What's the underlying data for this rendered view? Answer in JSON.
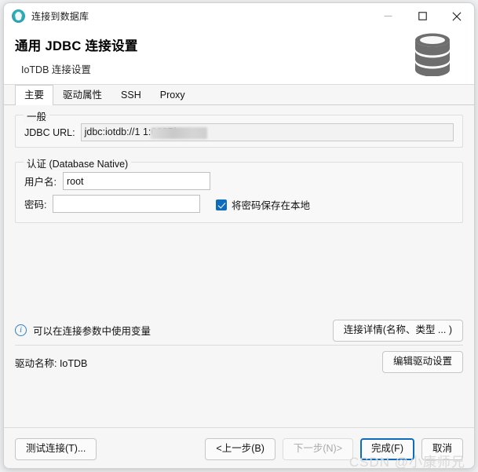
{
  "window": {
    "title": "连接到数据库",
    "app_icon": "dbeaver-icon",
    "controls": {
      "minimize": "minimize-icon",
      "maximize": "maximize-icon",
      "close": "close-icon"
    }
  },
  "header": {
    "title": "通用 JDBC 连接设置",
    "subtitle": "IoTDB 连接设置",
    "icon": "database-icon"
  },
  "tabs": [
    {
      "label": "主要",
      "active": true
    },
    {
      "label": "驱动属性",
      "active": false
    },
    {
      "label": "SSH",
      "active": false
    },
    {
      "label": "Proxy",
      "active": false
    }
  ],
  "general": {
    "legend": "一般",
    "jdbc_url_label": "JDBC URL:",
    "jdbc_url_value": "jdbc:iotdb://1                    1:6667/",
    "jdbc_url_prefix": "jdbc:iotdb://1",
    "jdbc_url_suffix": "1:6667/",
    "jdbc_url_redacted": true
  },
  "auth": {
    "legend": "认证 (Database Native)",
    "username_label": "用户名:",
    "username_value": "root",
    "password_label": "密码:",
    "password_value": "",
    "save_password_label": "将密码保存在本地",
    "save_password_checked": true
  },
  "info": {
    "icon": "info-icon",
    "text": "可以在连接参数中使用变量",
    "connection_details_button": "连接详情(名称、类型 ... )"
  },
  "driver": {
    "label": "驱动名称:",
    "name": "IoTDB",
    "label_full": "驱动名称: IoTDB",
    "edit_button": "编辑驱动设置"
  },
  "footer": {
    "test_connection": "测试连接(T)...",
    "back": "<上一步(B)",
    "next": "下一步(N)>",
    "finish": "完成(F)",
    "cancel": "取消",
    "next_disabled": true,
    "finish_focused": true
  },
  "watermark": "CSDN @小康师兄",
  "colors": {
    "accent": "#0f6cbd",
    "info": "#2f7ec4",
    "panel_bg": "#f6f6f6",
    "window_bg": "#ffffff",
    "db_icon": "#6e6e6e",
    "watermark": "#d9d9d9"
  }
}
